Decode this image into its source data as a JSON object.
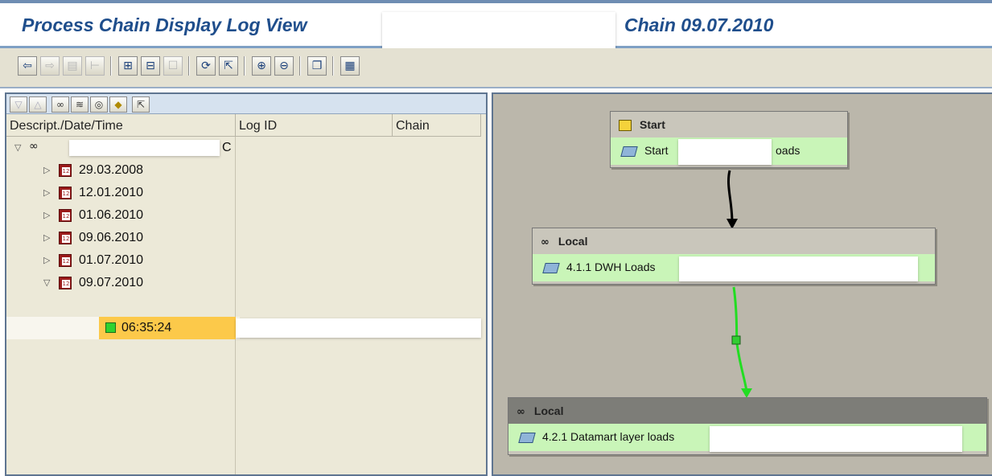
{
  "window": {
    "title": "Process Chain Display Log View",
    "title_suffix": "Chain 09.07.2010"
  },
  "toolbar": {
    "buttons": [
      "back-icon",
      "forward-icon",
      "list-icon",
      "tree-icon",
      "overview-icon",
      "hierarchy-icon",
      "script-icon",
      "refresh-icon",
      "export-icon",
      "zoom-in-icon",
      "zoom-out-icon",
      "windows-icon",
      "settings-icon"
    ]
  },
  "log_tree": {
    "columns": [
      "Descript./Date/Time",
      "Log ID",
      "Chain"
    ],
    "root_suffix": "C",
    "dates": [
      "29.03.2008",
      "12.01.2010",
      "01.06.2010",
      "09.06.2010",
      "01.07.2010",
      "09.07.2010"
    ],
    "selected_time": "06:35:24",
    "selected_status_color": "#2fd22f"
  },
  "diagram": {
    "start_node": {
      "header": "Start",
      "body_prefix": "Start",
      "body_suffix": "oads"
    },
    "local_node_1": {
      "header": "Local",
      "body": "4.1.1 DWH Loads"
    },
    "local_node_2": {
      "header": "Local",
      "body": "4.2.1 Datamart layer loads"
    },
    "link_colors": {
      "success": "#22dd22",
      "default": "#000000"
    }
  }
}
